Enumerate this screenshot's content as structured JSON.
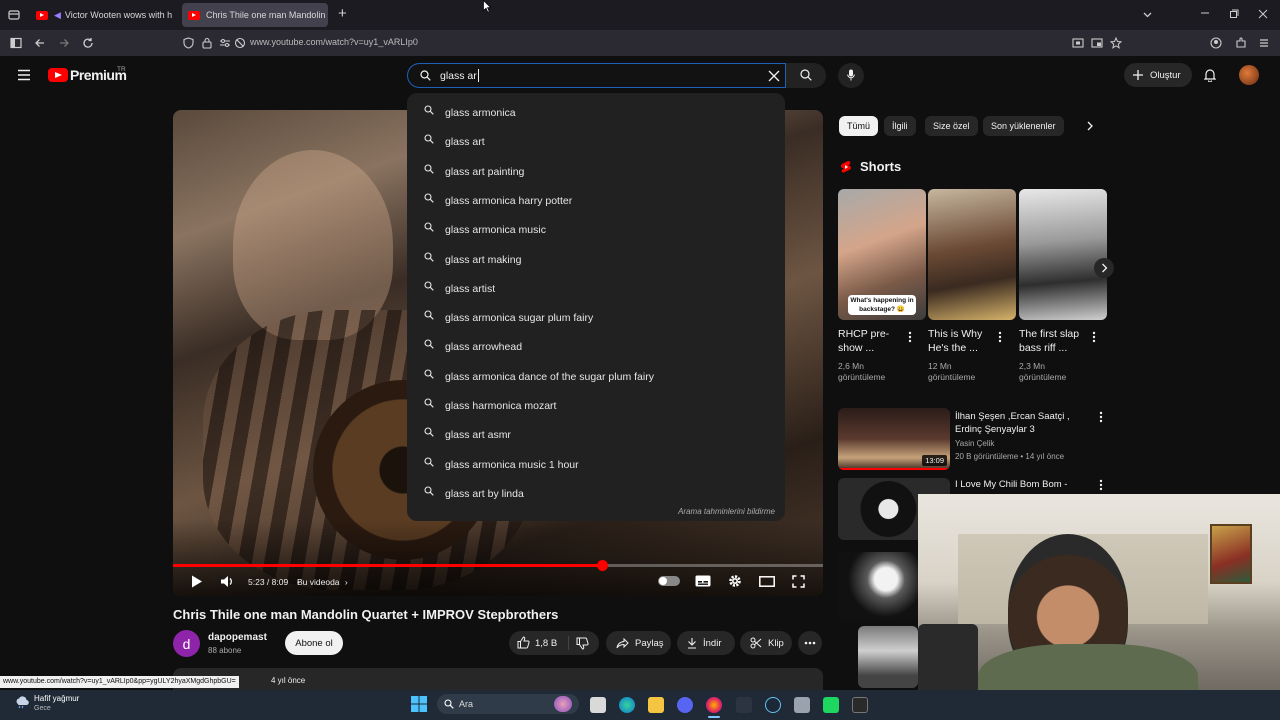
{
  "browser": {
    "tabs": [
      {
        "title": "Victor Wooten wows with h"
      },
      {
        "title": "Chris Thile one man Mandolin Q"
      }
    ],
    "new_tab": "+",
    "url": "www.youtube.com/watch?v=uy1_vARLIp0"
  },
  "yt": {
    "logo_text": "Premium",
    "logo_region": "TR",
    "search_query": "glass ar",
    "create_label": "Oluştur",
    "suggestions": [
      "glass armonica",
      "glass art",
      "glass art painting",
      "glass armonica harry potter",
      "glass armonica music",
      "glass art making",
      "glass artist",
      "glass armonica sugar plum fairy",
      "glass arrowhead",
      "glass armonica dance of the sugar plum fairy",
      "glass harmonica mozart",
      "glass art asmr",
      "glass armonica music 1 hour",
      "glass art by linda"
    ],
    "report_predictions": "Arama tahminlerini bildirme"
  },
  "player": {
    "time": "5:23 / 8:09",
    "chapter": "Bu videoda",
    "progress": 0.66
  },
  "video": {
    "title": "Chris Thile one man Mandolin Quartet + IMPROV Stepbrothers",
    "channel": "dapopemast",
    "channel_initial": "d",
    "subscribers": "88 abone",
    "subscribe_label": "Abone ol",
    "likes": "1,8 B",
    "share_label": "Paylaş",
    "download_label": "İndir",
    "clip_label": "Klip",
    "date_fragment": "4 yıl önce"
  },
  "chips": [
    "Tümü",
    "İlgili",
    "Size özel",
    "Son yüklenenler"
  ],
  "shorts": {
    "heading": "Shorts",
    "items": [
      {
        "title_line1": "RHCP pre-",
        "title_line2": "show ...",
        "views_line1": "2,6 Mn",
        "views_line2": "görüntüleme",
        "overlay": "What's happening in backstage? 😀"
      },
      {
        "title_line1": "This is Why",
        "title_line2": "He's the ...",
        "views_line1": "12 Mn",
        "views_line2": "görüntüleme"
      },
      {
        "title_line1": "The first slap",
        "title_line2": "bass riff ...",
        "views_line1": "2,3 Mn",
        "views_line2": "görüntüleme"
      }
    ]
  },
  "recommendations": [
    {
      "title_line1": "İlhan Şeşen ,Ercan Saatçi ,",
      "title_line2": "Erdinç Şenyaylar 3",
      "channel": "Yasin Çelik",
      "meta": "20 B görüntüleme • 14 yıl önce",
      "duration": "13:09"
    },
    {
      "title_line1": "I Love My Chili Bom Bom -",
      "title_line2": "",
      "channel": "",
      "meta": "",
      "duration": ""
    }
  ],
  "status_url": "www.youtube.com/watch?v=uy1_vARLIp0&pp=ygULY2hyaXMgdGhpbGU=",
  "taskbar": {
    "weather_label": "Hafif yağmur",
    "weather_sub": "Gece",
    "search_placeholder": "Ara"
  }
}
